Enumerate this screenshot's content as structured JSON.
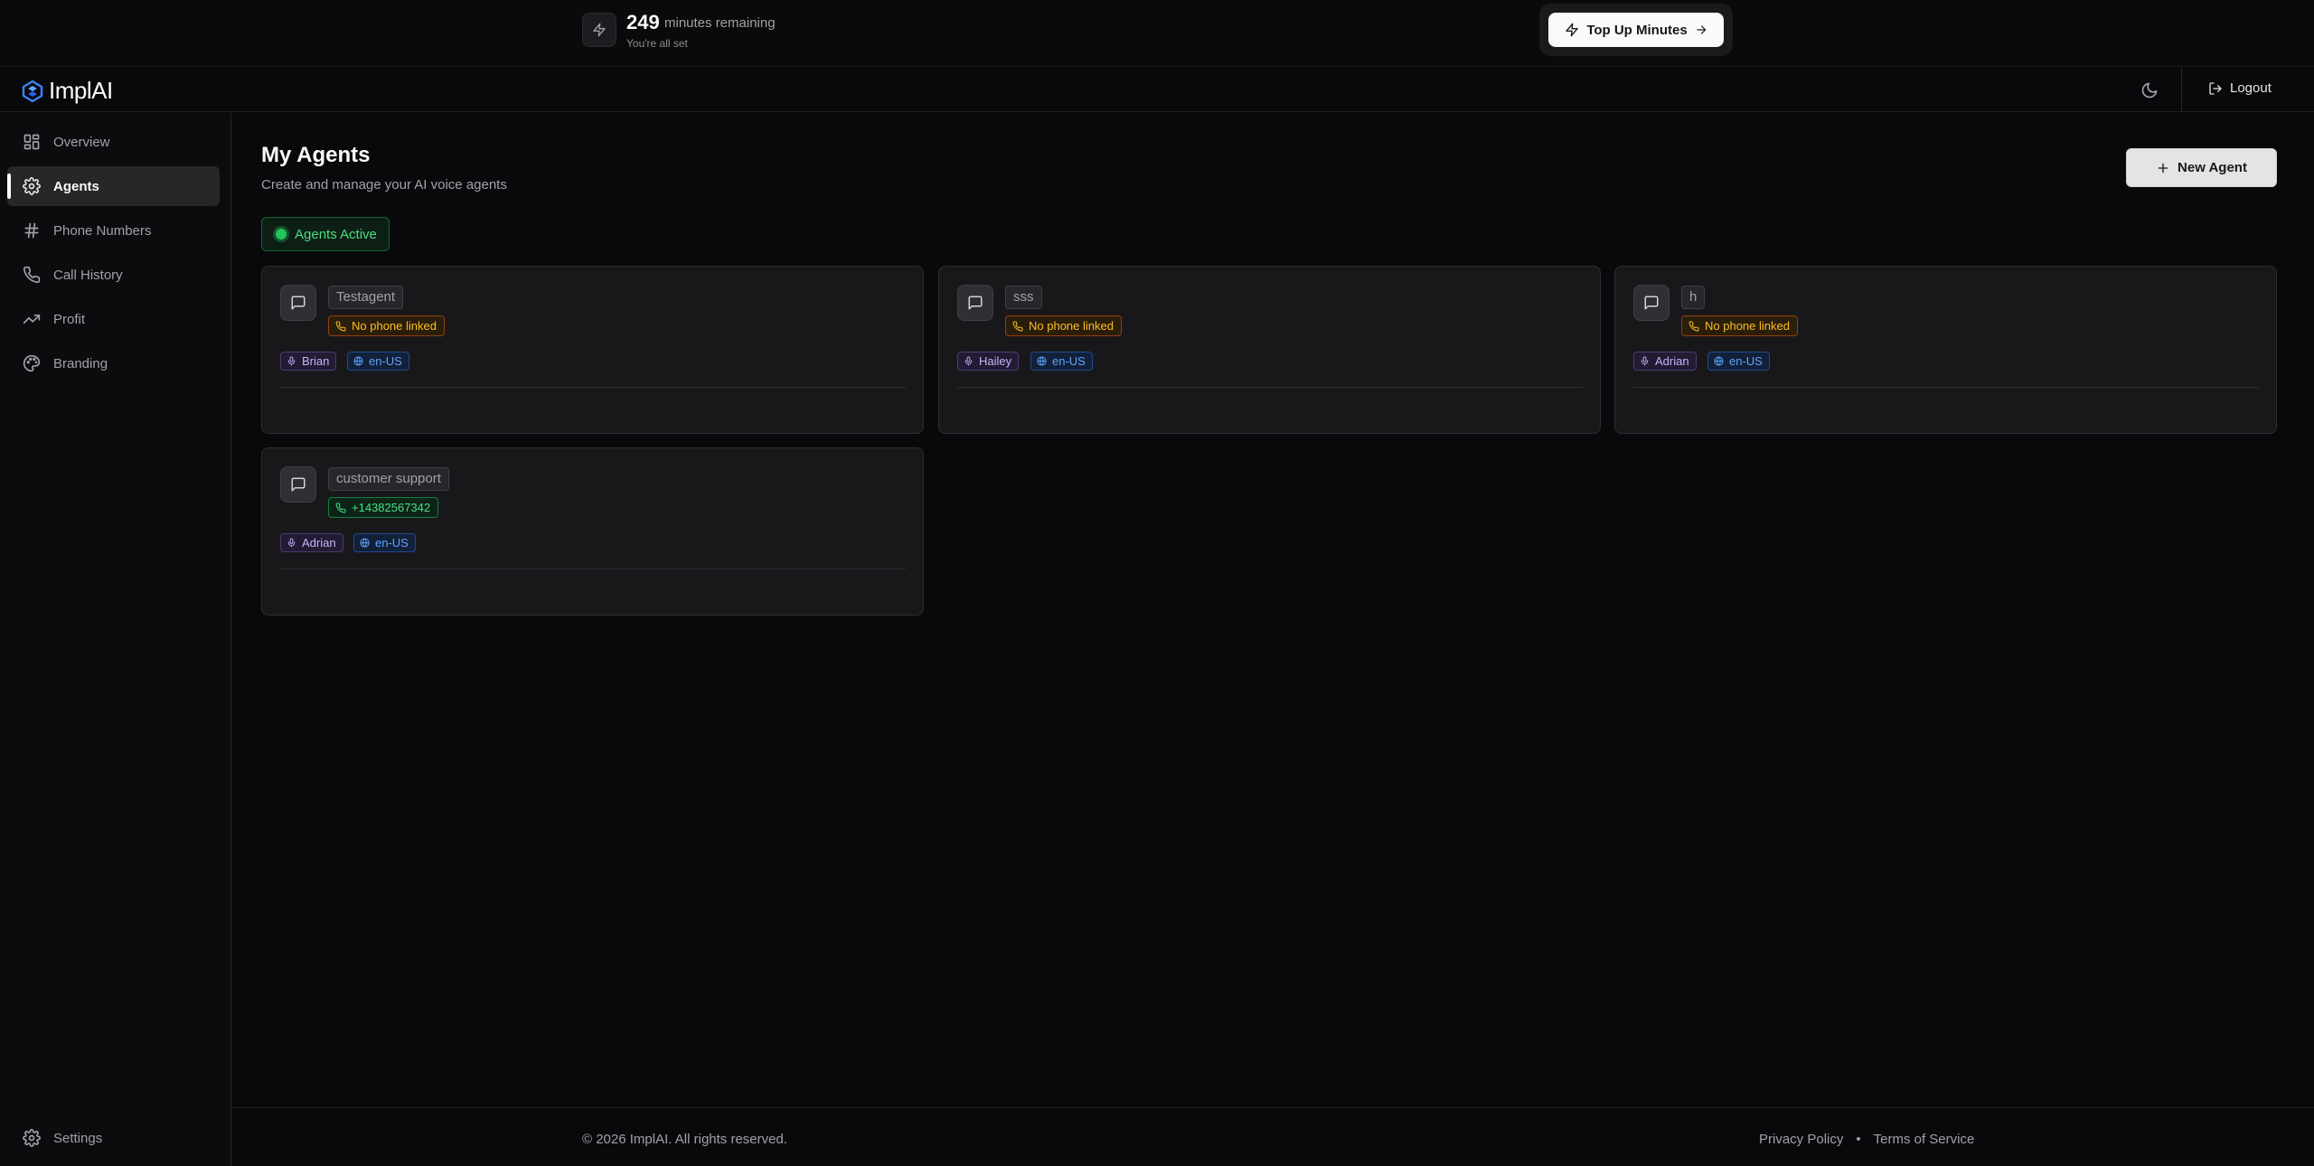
{
  "credits": {
    "minutes": "249",
    "unit_label": "minutes remaining",
    "status": "You're all set",
    "topup_label": "Top Up Minutes"
  },
  "header": {
    "brand": "ImplAI",
    "logout_label": "Logout"
  },
  "sidebar": {
    "items": [
      {
        "label": "Overview",
        "icon": "layout-dashboard-icon",
        "active": false
      },
      {
        "label": "Agents",
        "icon": "gear-icon",
        "active": true
      },
      {
        "label": "Phone Numbers",
        "icon": "hash-icon",
        "active": false
      },
      {
        "label": "Call History",
        "icon": "phone-icon",
        "active": false
      },
      {
        "label": "Profit",
        "icon": "trending-up-icon",
        "active": false
      },
      {
        "label": "Branding",
        "icon": "palette-icon",
        "active": false
      }
    ],
    "settings_label": "Settings"
  },
  "main": {
    "title": "My Agents",
    "subtitle": "Create and manage your AI voice agents",
    "new_agent_label": "New Agent",
    "status_label": "Agents Active",
    "agents": [
      {
        "name": "Testagent",
        "phone": "No phone linked",
        "phone_linked": false,
        "voice": "Brian",
        "language": "en-US"
      },
      {
        "name": "sss",
        "phone": "No phone linked",
        "phone_linked": false,
        "voice": "Hailey",
        "language": "en-US"
      },
      {
        "name": "h",
        "phone": "No phone linked",
        "phone_linked": false,
        "voice": "Adrian",
        "language": "en-US"
      },
      {
        "name": "customer support",
        "phone": "+14382567342",
        "phone_linked": true,
        "voice": "Adrian",
        "language": "en-US"
      }
    ]
  },
  "footer": {
    "copyright": "© 2026 ImplAI. All rights reserved.",
    "privacy_label": "Privacy Policy",
    "separator": "•",
    "terms_label": "Terms of Service"
  },
  "colors": {
    "background": "#09090b",
    "accent_success": "#22c55e",
    "warning": "#fbbf24",
    "brand_blue": "#3b82f6"
  }
}
